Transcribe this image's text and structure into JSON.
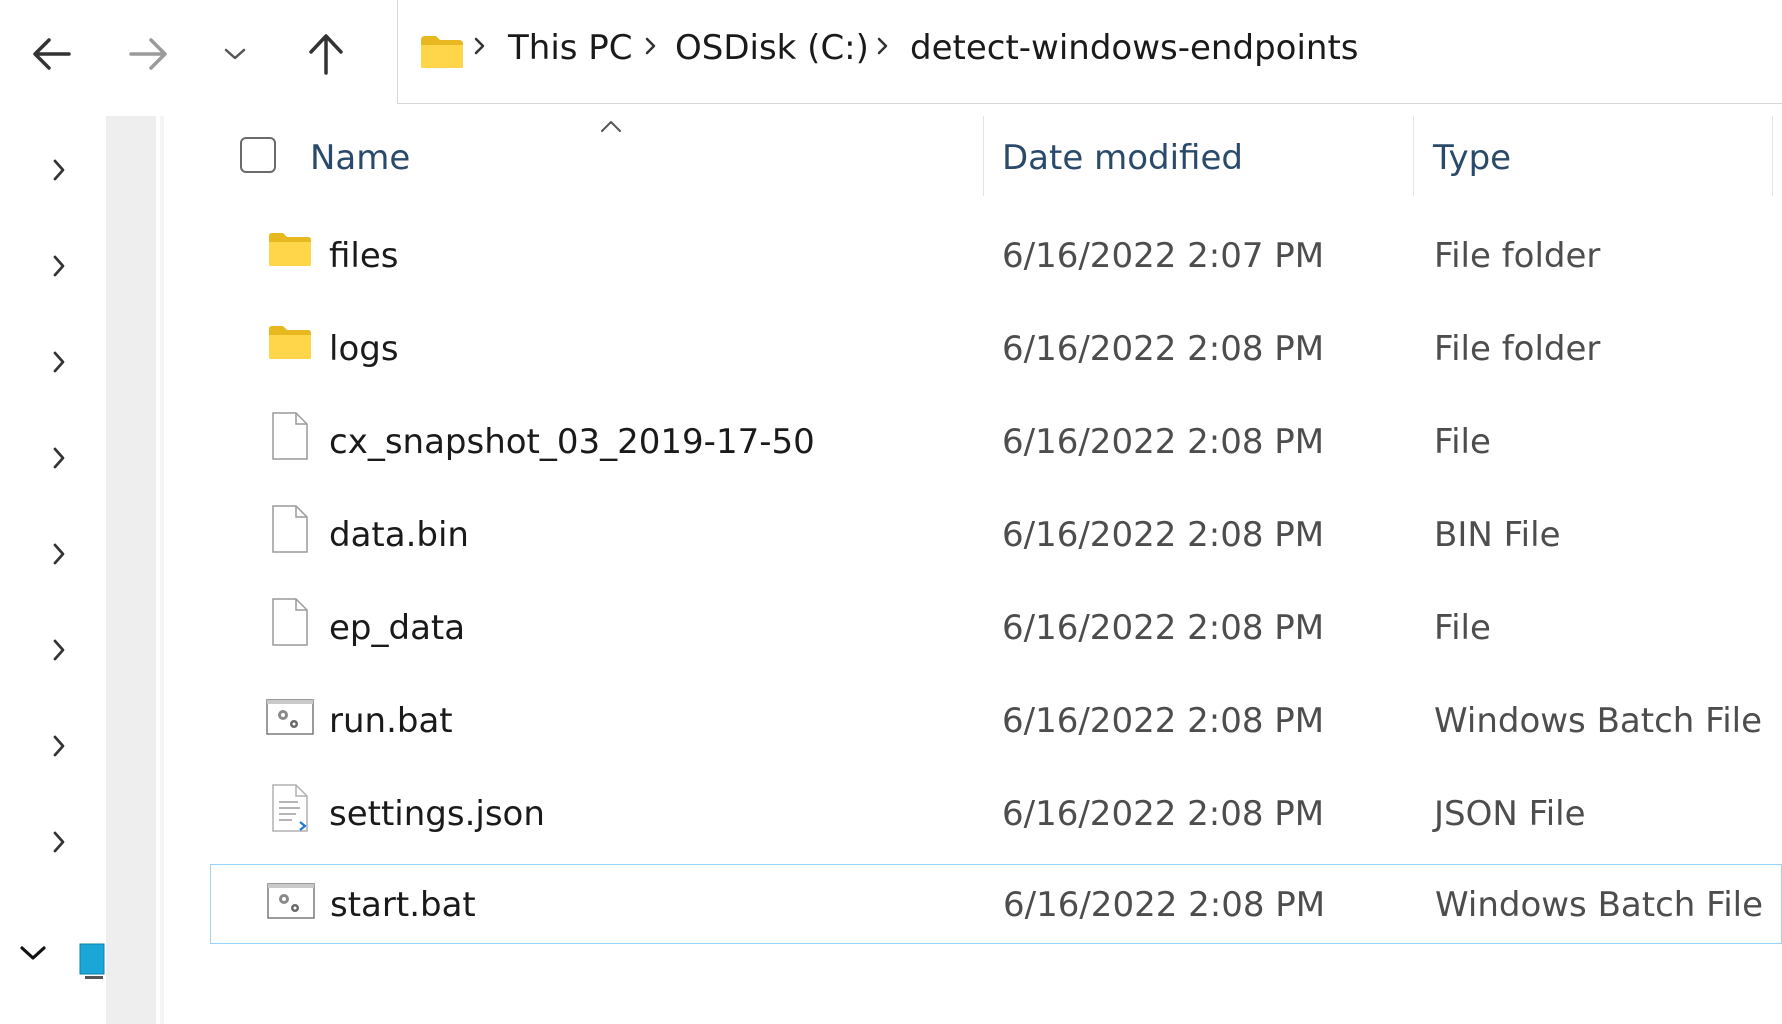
{
  "toolbar": {
    "back_icon": "arrow-left-icon",
    "forward_icon": "arrow-right-icon",
    "recent_icon": "chevron-down-icon",
    "up_icon": "arrow-up-icon"
  },
  "address": {
    "folder_icon": "folder-icon",
    "crumbs": [
      "This PC",
      "OSDisk (C:)",
      "detect-windows-endpoints"
    ]
  },
  "columns": {
    "name": "Name",
    "date": "Date modified",
    "type": "Type"
  },
  "files": [
    {
      "name": "files",
      "date": "6/16/2022 2:07 PM",
      "type": "File folder",
      "icon": "folder-icon"
    },
    {
      "name": "logs",
      "date": "6/16/2022 2:08 PM",
      "type": "File folder",
      "icon": "folder-icon"
    },
    {
      "name": "cx_snapshot_03_2019-17-50",
      "date": "6/16/2022 2:08 PM",
      "type": "File",
      "icon": "file-icon"
    },
    {
      "name": "data.bin",
      "date": "6/16/2022 2:08 PM",
      "type": "BIN File",
      "icon": "file-icon"
    },
    {
      "name": "ep_data",
      "date": "6/16/2022 2:08 PM",
      "type": "File",
      "icon": "file-icon"
    },
    {
      "name": "run.bat",
      "date": "6/16/2022 2:08 PM",
      "type": "Windows Batch File",
      "icon": "batch-file-icon"
    },
    {
      "name": "settings.json",
      "date": "6/16/2022 2:08 PM",
      "type": "JSON File",
      "icon": "json-file-icon"
    },
    {
      "name": "start.bat",
      "date": "6/16/2022 2:08 PM",
      "type": "Windows Batch File",
      "icon": "batch-file-icon"
    }
  ],
  "selected_file": "start.bat",
  "colors": {
    "selection_border": "#99d1ff",
    "header_text": "#2a4a6b",
    "folder_yellow": "#ffd54a"
  }
}
